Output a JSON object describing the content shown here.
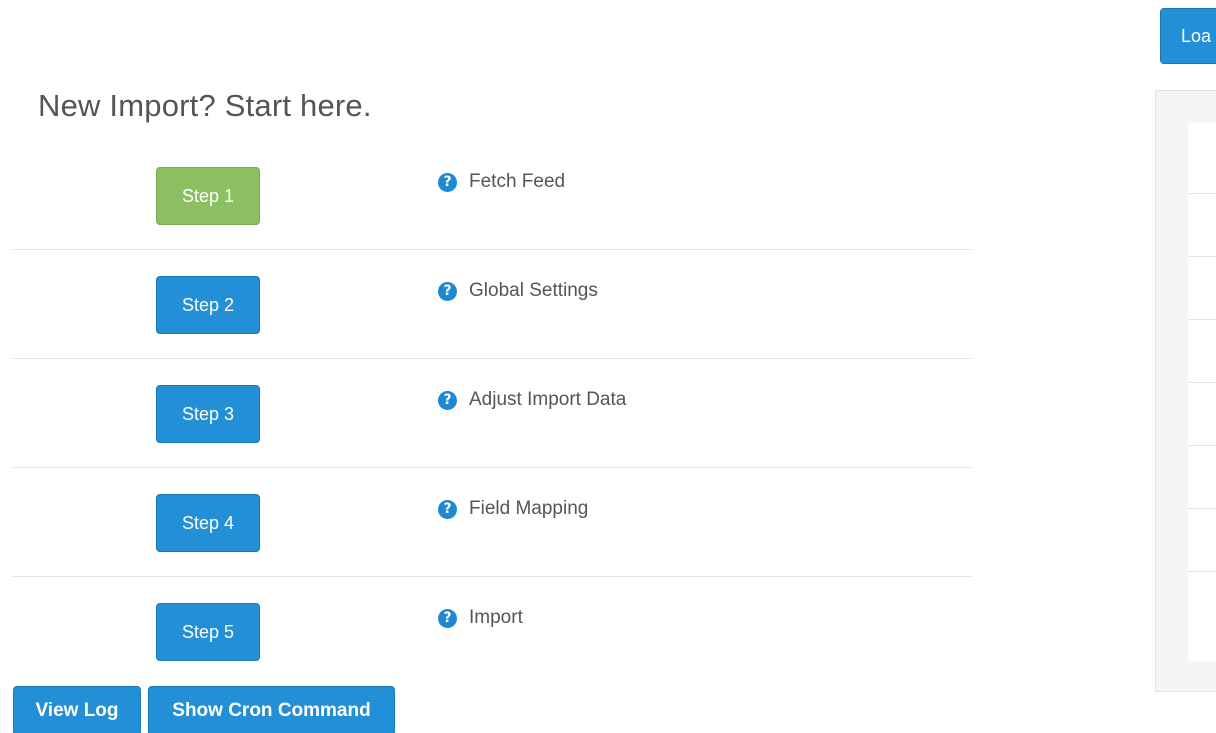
{
  "heading": "New Import? Start here.",
  "steps": [
    {
      "button": "Step 1",
      "label": "Fetch Feed",
      "state": "active"
    },
    {
      "button": "Step 2",
      "label": "Global Settings",
      "state": "default"
    },
    {
      "button": "Step 3",
      "label": "Adjust Import Data",
      "state": "default"
    },
    {
      "button": "Step 4",
      "label": "Field Mapping",
      "state": "default"
    },
    {
      "button": "Step 5",
      "label": "Import",
      "state": "default"
    }
  ],
  "help_icon_glyph": "?",
  "actions": {
    "view_log": "View Log",
    "show_cron": "Show Cron Command"
  },
  "load_button": "Loa",
  "colors": {
    "primary": "#238fd6",
    "success": "#8cbf61",
    "text": "#555555"
  }
}
